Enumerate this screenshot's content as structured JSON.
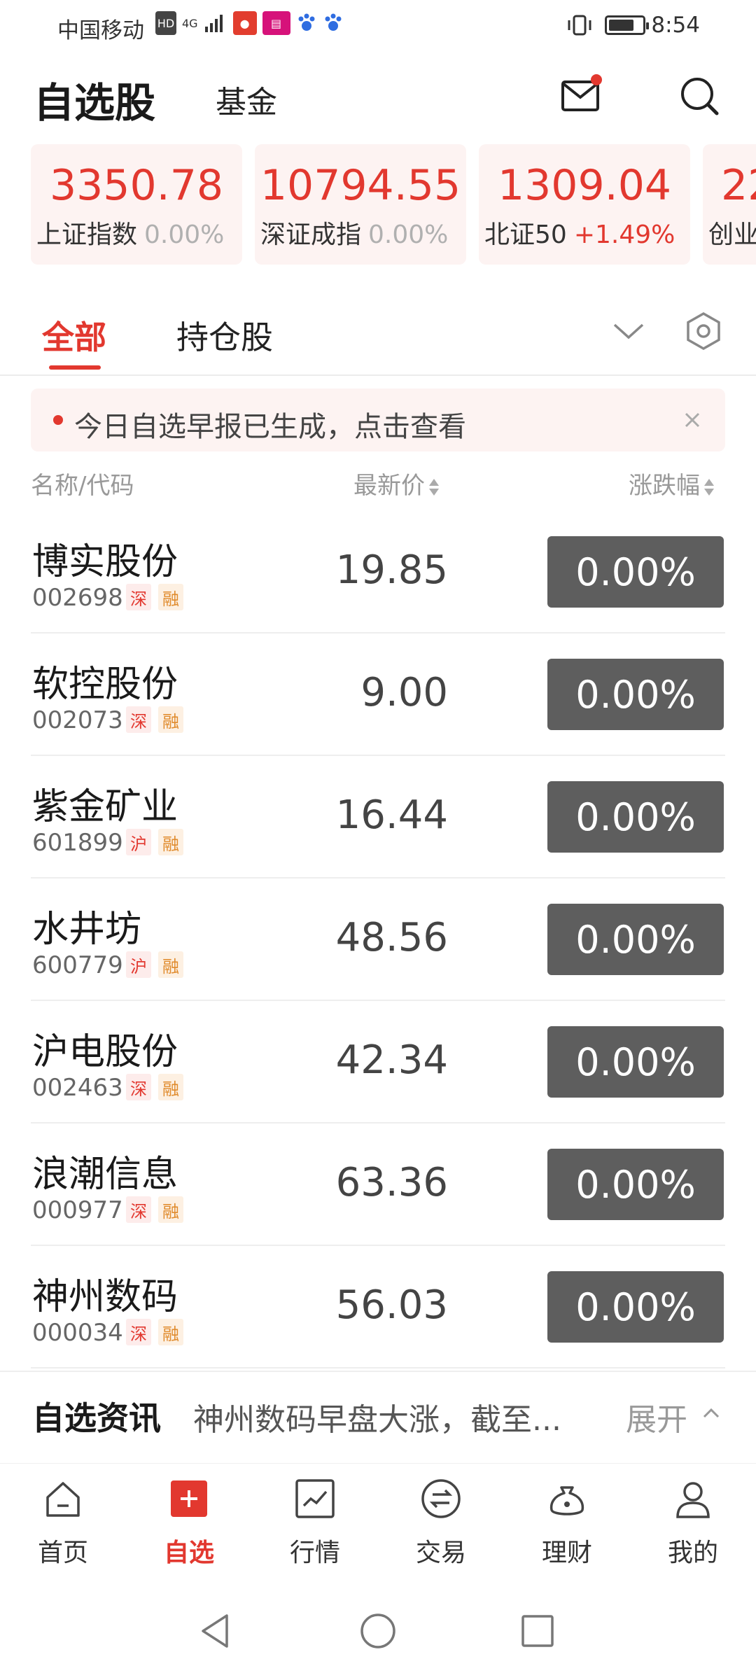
{
  "status_bar": {
    "carrier": "中国移动",
    "hd_badge": "HD",
    "network": "4G",
    "time": "8:54",
    "battery_level": 0.75
  },
  "header": {
    "title": "自选股",
    "fund_tab": "基金"
  },
  "indices": [
    {
      "value": "3350.78",
      "name": "上证指数",
      "change": "0.00%",
      "change_color": "#b0b0b0"
    },
    {
      "value": "10794.55",
      "name": "深证成指",
      "change": "0.00%",
      "change_color": "#b0b0b0"
    },
    {
      "value": "1309.04",
      "name": "北证50",
      "change": "+1.49%",
      "change_color": "#e2382f"
    },
    {
      "value": "22",
      "name": "创业",
      "change": "",
      "change_color": "#b0b0b0"
    }
  ],
  "tabs": {
    "all": "全部",
    "holdings": "持仓股"
  },
  "banner": {
    "text": "今日自选早报已生成，点击查看"
  },
  "columns": {
    "name": "名称/代码",
    "price": "最新价",
    "change": "涨跌幅"
  },
  "stocks": [
    {
      "name": "博实股份",
      "code": "002698",
      "exchange": "深",
      "margin": "融",
      "price": "19.85",
      "change": "0.00%"
    },
    {
      "name": "软控股份",
      "code": "002073",
      "exchange": "深",
      "margin": "融",
      "price": "9.00",
      "change": "0.00%"
    },
    {
      "name": "紫金矿业",
      "code": "601899",
      "exchange": "沪",
      "margin": "融",
      "price": "16.44",
      "change": "0.00%"
    },
    {
      "name": "水井坊",
      "code": "600779",
      "exchange": "沪",
      "margin": "融",
      "price": "48.56",
      "change": "0.00%"
    },
    {
      "name": "沪电股份",
      "code": "002463",
      "exchange": "深",
      "margin": "融",
      "price": "42.34",
      "change": "0.00%"
    },
    {
      "name": "浪潮信息",
      "code": "000977",
      "exchange": "深",
      "margin": "融",
      "price": "63.36",
      "change": "0.00%"
    },
    {
      "name": "神州数码",
      "code": "000034",
      "exchange": "深",
      "margin": "融",
      "price": "56.03",
      "change": "0.00%"
    }
  ],
  "news": {
    "title": "自选资讯",
    "text": "神州数码早盘大涨，截至...",
    "expand": "展开"
  },
  "bottom_nav": [
    {
      "label": "首页",
      "icon": "home-icon"
    },
    {
      "label": "自选",
      "icon": "plus-icon"
    },
    {
      "label": "行情",
      "icon": "chart-icon"
    },
    {
      "label": "交易",
      "icon": "exchange-icon"
    },
    {
      "label": "理财",
      "icon": "money-bag-icon"
    },
    {
      "label": "我的",
      "icon": "user-icon"
    }
  ],
  "colors": {
    "accent": "#e2382f",
    "change_neutral_bg": "#5e5e5e",
    "card_bg": "#fdf3f2"
  }
}
